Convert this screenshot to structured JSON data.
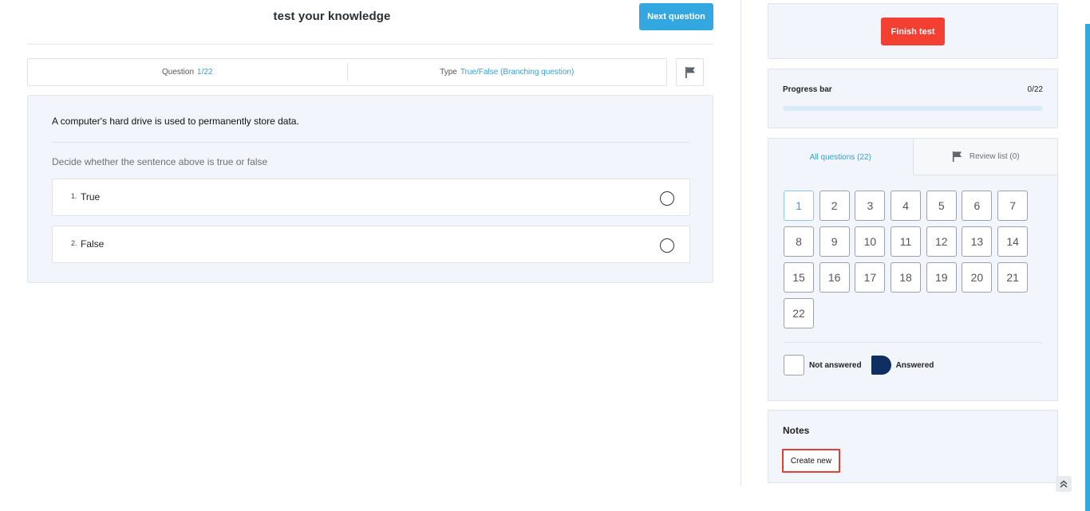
{
  "header": {
    "title": "test your knowledge",
    "next_label": "Next question"
  },
  "question_info": {
    "question_label": "Question",
    "question_value": "1/22",
    "type_label": "Type",
    "type_value": "True/False (Branching question)"
  },
  "question": {
    "text": "A computer's hard drive is used to permanently store data.",
    "instruction": "Decide whether the sentence above is true or false",
    "options": [
      {
        "number": "1.",
        "label": "True"
      },
      {
        "number": "2.",
        "label": "False"
      }
    ]
  },
  "sidebar": {
    "finish_label": "Finish test",
    "progress": {
      "label": "Progress bar",
      "count": "0/22",
      "fraction": 0
    },
    "tabs": {
      "all_questions": "All questions (22)",
      "review_list": "Review list (0)"
    },
    "question_numbers": [
      "1",
      "2",
      "3",
      "4",
      "5",
      "6",
      "7",
      "8",
      "9",
      "10",
      "11",
      "12",
      "13",
      "14",
      "15",
      "16",
      "17",
      "18",
      "19",
      "20",
      "21",
      "22"
    ],
    "current_question": "1",
    "legend": {
      "not_answered": "Not answered",
      "answered": "Answered"
    },
    "notes": {
      "title": "Notes",
      "create_label": "Create new"
    }
  },
  "colors": {
    "accent": "#33a8e0",
    "finish": "#f43f33",
    "answered": "#0f2f63",
    "highlight": "#e0403a"
  },
  "icons": {
    "flag": "flag-icon",
    "review_flag": "flag-icon",
    "scroll_top": "double-chevron-up-icon"
  }
}
